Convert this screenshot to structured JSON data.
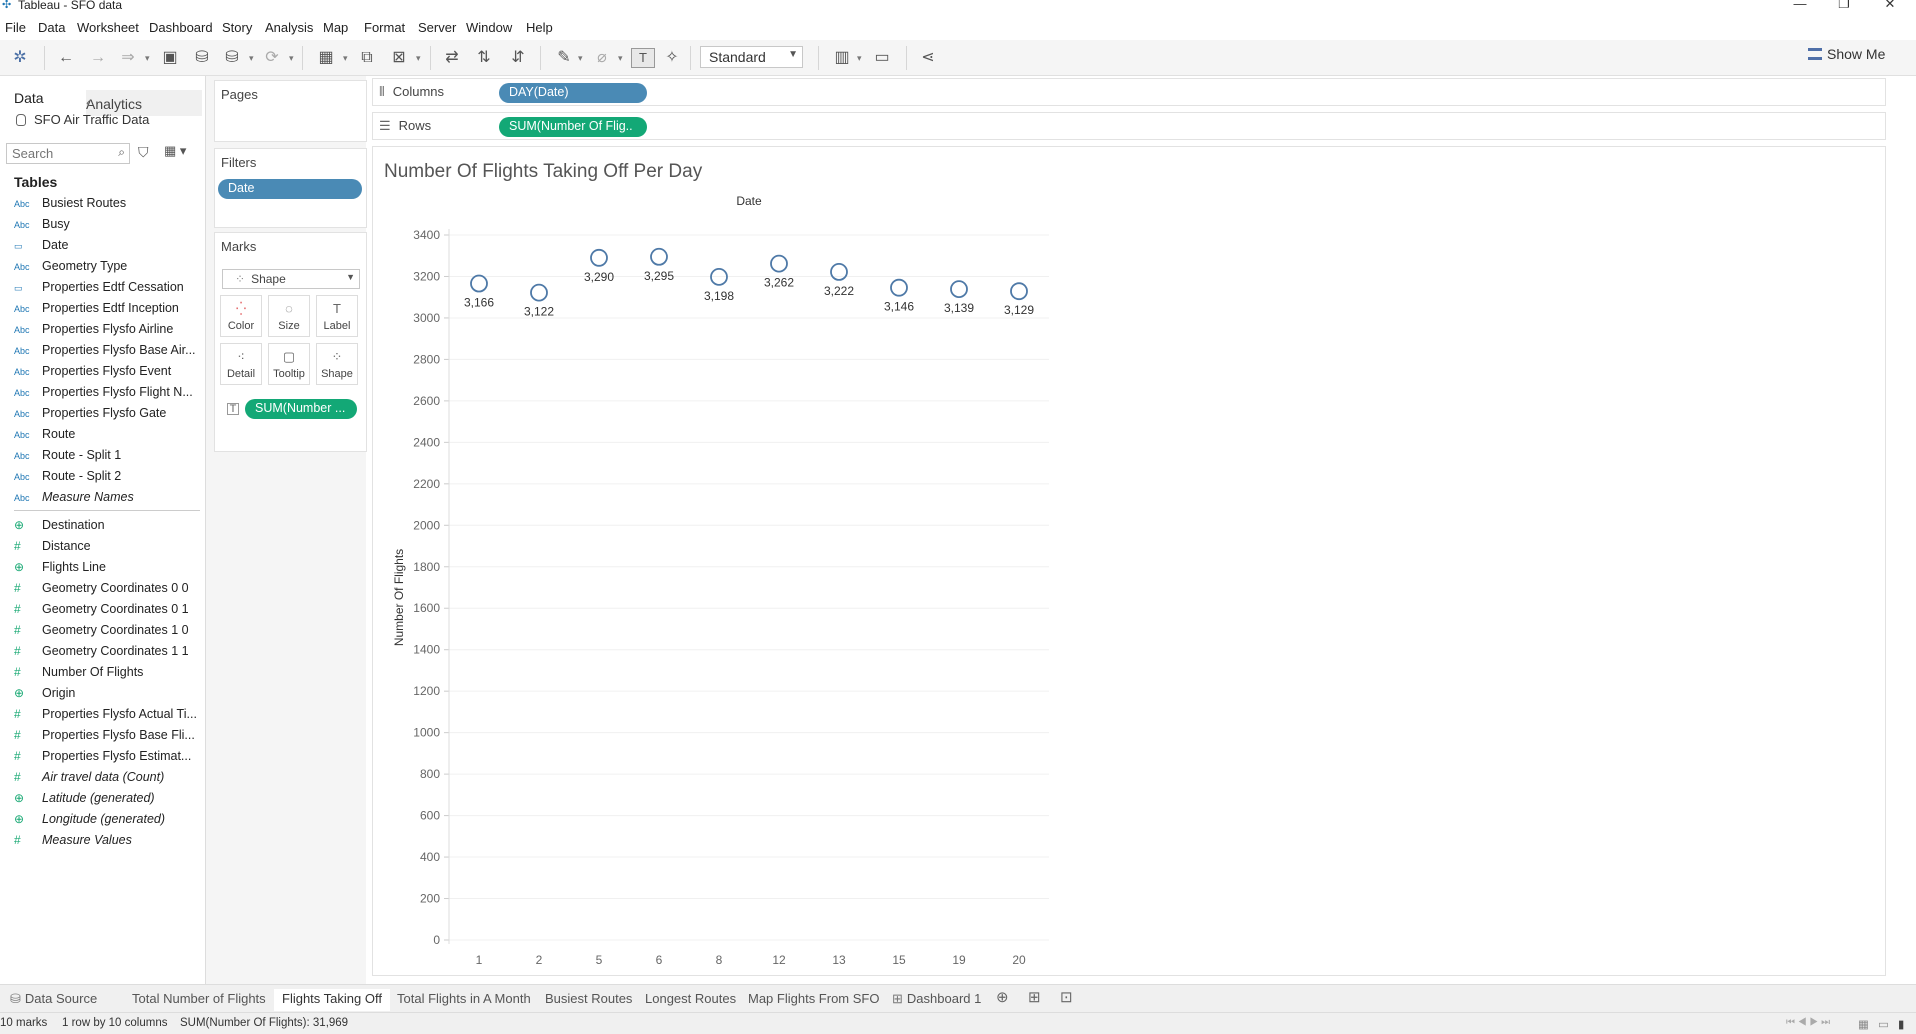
{
  "window": {
    "title": "Tableau - SFO data",
    "controls": {
      "minimize": "—",
      "restore": "❐",
      "close": "✕"
    }
  },
  "menu": [
    "File",
    "Data",
    "Worksheet",
    "Dashboard",
    "Story",
    "Analysis",
    "Map",
    "Format",
    "Server",
    "Window",
    "Help"
  ],
  "toolbar": {
    "fit_select": "Standard",
    "show_me": "Show Me"
  },
  "left_pane": {
    "tab_data": "Data",
    "tab_analytics": "Analytics",
    "collapse_icon": "‹",
    "datasource": "SFO Air Traffic Data",
    "search_placeholder": "Search",
    "tables_heading": "Tables",
    "dimensions": [
      {
        "type": "Abc",
        "name": "Busiest Routes",
        "italic": false
      },
      {
        "type": "Abc",
        "name": "Busy",
        "italic": false
      },
      {
        "type": "date",
        "name": "Date",
        "italic": false
      },
      {
        "type": "Abc",
        "name": "Geometry Type",
        "italic": false
      },
      {
        "type": "date",
        "name": "Properties Edtf Cessation",
        "italic": false
      },
      {
        "type": "Abc",
        "name": "Properties Edtf Inception",
        "italic": false
      },
      {
        "type": "Abc",
        "name": "Properties Flysfo Airline",
        "italic": false
      },
      {
        "type": "Abc",
        "name": "Properties Flysfo Base Air...",
        "italic": false
      },
      {
        "type": "Abc",
        "name": "Properties Flysfo Event",
        "italic": false
      },
      {
        "type": "Abc",
        "name": "Properties Flysfo Flight N...",
        "italic": false
      },
      {
        "type": "Abc",
        "name": "Properties Flysfo Gate",
        "italic": false
      },
      {
        "type": "Abc",
        "name": "Route",
        "italic": false
      },
      {
        "type": "Abc",
        "name": "Route - Split 1",
        "italic": false
      },
      {
        "type": "Abc",
        "name": "Route - Split 2",
        "italic": false
      },
      {
        "type": "Abc",
        "name": "Measure Names",
        "italic": true
      }
    ],
    "measures": [
      {
        "type": "geo",
        "name": "Destination",
        "italic": false
      },
      {
        "type": "#",
        "name": "Distance",
        "italic": false
      },
      {
        "type": "geo",
        "name": "Flights Line",
        "italic": false
      },
      {
        "type": "#",
        "name": "Geometry Coordinates 0 0",
        "italic": false
      },
      {
        "type": "#",
        "name": "Geometry Coordinates 0 1",
        "italic": false
      },
      {
        "type": "#",
        "name": "Geometry Coordinates 1 0",
        "italic": false
      },
      {
        "type": "#",
        "name": "Geometry Coordinates 1 1",
        "italic": false
      },
      {
        "type": "#",
        "name": "Number Of Flights",
        "italic": false
      },
      {
        "type": "geo",
        "name": "Origin",
        "italic": false
      },
      {
        "type": "#",
        "name": "Properties Flysfo Actual Ti...",
        "italic": false
      },
      {
        "type": "#",
        "name": "Properties Flysfo Base Fli...",
        "italic": false
      },
      {
        "type": "#",
        "name": "Properties Flysfo Estimat...",
        "italic": false
      },
      {
        "type": "#",
        "name": "Air travel data (Count)",
        "italic": true
      },
      {
        "type": "geo",
        "name": "Latitude (generated)",
        "italic": true
      },
      {
        "type": "geo",
        "name": "Longitude (generated)",
        "italic": true
      },
      {
        "type": "#",
        "name": "Measure Values",
        "italic": true
      }
    ]
  },
  "shelves": {
    "pages_label": "Pages",
    "filters_label": "Filters",
    "filter_pill": "Date",
    "marks_label": "Marks",
    "mark_type": "Shape",
    "mark_buttons": [
      "Color",
      "Size",
      "Label",
      "Detail",
      "Tooltip",
      "Shape"
    ],
    "marks_pill": "SUM(Number ...",
    "columns_label": "Columns",
    "columns_pill": "DAY(Date)",
    "rows_label": "Rows",
    "rows_pill": "SUM(Number Of Flig.."
  },
  "viz": {
    "title": "Number Of  Flights Taking Off Per Day"
  },
  "chart_data": {
    "type": "scatter",
    "mark": "open-circle",
    "title": "Number Of  Flights Taking Off Per Day",
    "top_axis_label": "Date",
    "ylabel": "Number Of Flights",
    "xlabel": "",
    "categories": [
      "1",
      "2",
      "5",
      "6",
      "8",
      "12",
      "13",
      "15",
      "19",
      "20"
    ],
    "values": [
      3166,
      3122,
      3290,
      3295,
      3198,
      3262,
      3222,
      3146,
      3139,
      3129
    ],
    "data_labels": [
      "3,166",
      "3,122",
      "3,290",
      "3,295",
      "3,198",
      "3,262",
      "3,222",
      "3,146",
      "3,139",
      "3,129"
    ],
    "ylim": [
      0,
      3400
    ],
    "yticks": [
      "0",
      "200",
      "400",
      "600",
      "800",
      "1000",
      "1200",
      "1400",
      "1600",
      "1800",
      "2000",
      "2200",
      "2400",
      "2600",
      "2800",
      "3000",
      "3200",
      "3400"
    ],
    "grid": true,
    "mark_color": "#4e79a7"
  },
  "sheet_tabs": {
    "data_source": "Data Source",
    "tabs": [
      "Total Number of Flights",
      "Flights Taking Off",
      "Total Flights in A Month",
      "Busiest Routes",
      "Longest Routes",
      "Map Flights From SFO",
      "Dashboard 1"
    ],
    "active": "Flights Taking Off"
  },
  "status": {
    "marks": "10 marks",
    "rows_cols": "1 row by 10 columns",
    "sum": "SUM(Number Of Flights): 31,969"
  }
}
